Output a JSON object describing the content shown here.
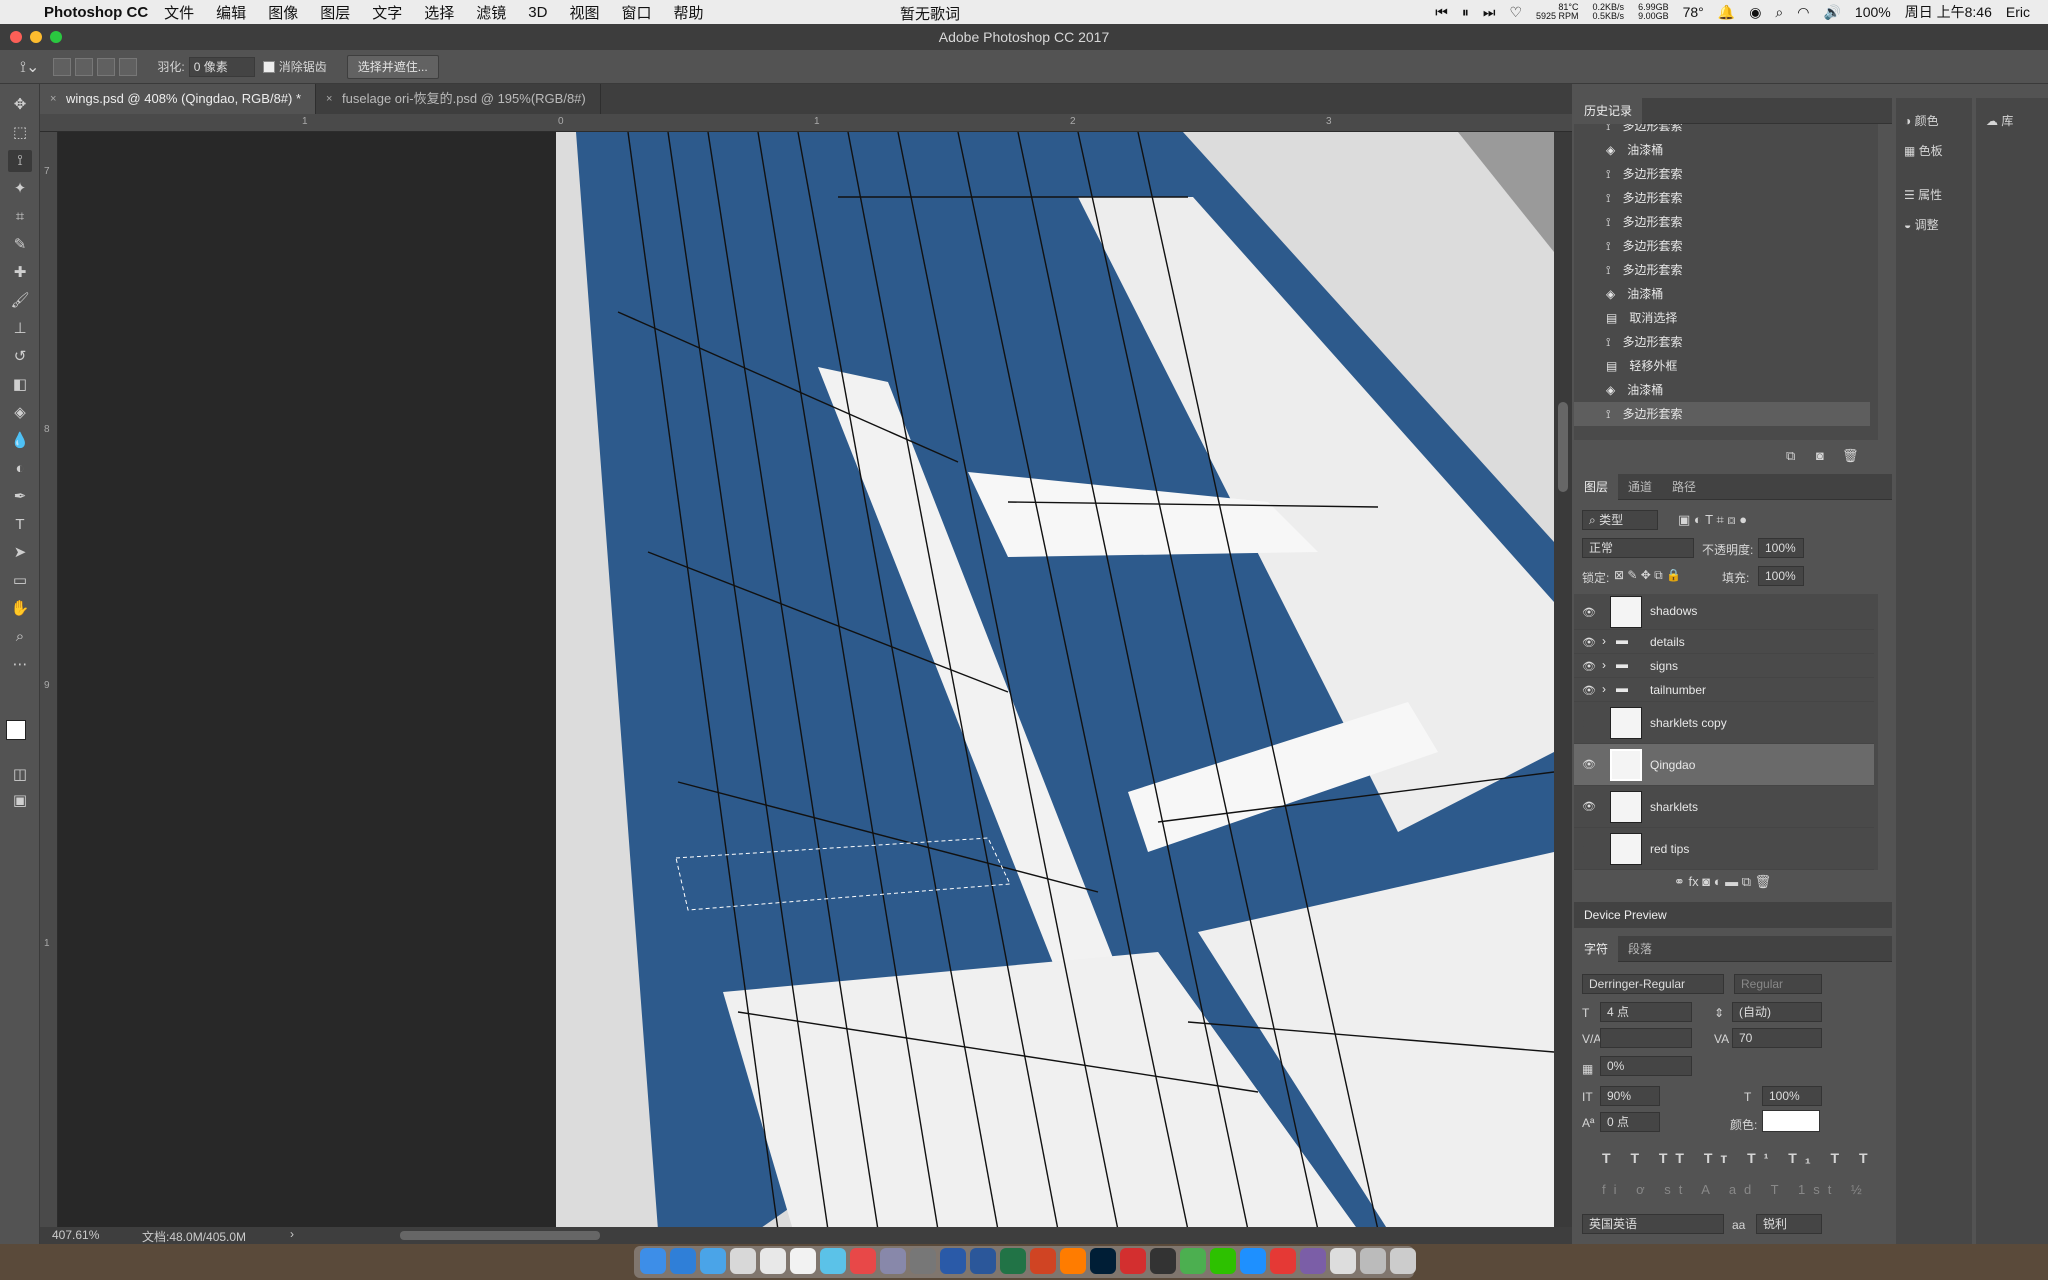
{
  "menubar": {
    "app": "Photoshop CC",
    "items": [
      "文件",
      "编辑",
      "图像",
      "图层",
      "文字",
      "选择",
      "滤镜",
      "3D",
      "视图",
      "窗口",
      "帮助"
    ],
    "center": "暂无歌词",
    "temp": "81°C",
    "rpm": "5925 RPM",
    "net_up": "0.2KB/s",
    "net_down": "0.5KB/s",
    "mem_u": "6.99GB",
    "mem_f": "9.00GB",
    "weather": "78°",
    "battery": "100%",
    "datetime": "周日 上午8:46",
    "user": "Eric"
  },
  "window": {
    "title": "Adobe Photoshop CC 2017"
  },
  "options": {
    "feather_label": "羽化:",
    "feather_value": "0 像素",
    "antialias_label": "消除锯齿",
    "select_mask_button": "选择并遮住..."
  },
  "doc_tabs": [
    {
      "label": "wings.psd @ 408% (Qingdao, RGB/8#) *",
      "active": true
    },
    {
      "label": "fuselage ori-恢复的.psd @ 195%(RGB/8#)",
      "active": false
    }
  ],
  "ruler": {
    "h_labels": [
      "1",
      "0",
      "1",
      "2",
      "3"
    ],
    "v_labels": [
      "7",
      "8",
      "9",
      "1"
    ]
  },
  "status": {
    "zoom": "407.61%",
    "doc": "文档:48.0M/405.0M"
  },
  "history": {
    "title": "历史记录",
    "items": [
      "多边形套索",
      "油漆桶",
      "多边形套索",
      "多边形套索",
      "多边形套索",
      "多边形套索",
      "多边形套索",
      "油漆桶",
      "取消选择",
      "多边形套索",
      "轻移外框",
      "油漆桶",
      "多边形套索"
    ]
  },
  "right_dock": {
    "items": [
      "颜色",
      "色板",
      "属性",
      "调整"
    ],
    "lib": "库"
  },
  "layers": {
    "tabs": [
      "图层",
      "通道",
      "路径"
    ],
    "filter": "类型",
    "blend": "正常",
    "opacity_label": "不透明度:",
    "opacity": "100%",
    "lock_label": "锁定:",
    "fill_label": "填充:",
    "fill": "100%",
    "items": [
      {
        "name": "shadows",
        "visible": true,
        "kind": "layer"
      },
      {
        "name": "details",
        "visible": true,
        "kind": "group"
      },
      {
        "name": "signs",
        "visible": true,
        "kind": "group"
      },
      {
        "name": "tailnumber",
        "visible": true,
        "kind": "group"
      },
      {
        "name": "sharklets copy",
        "visible": false,
        "kind": "layer"
      },
      {
        "name": "Qingdao",
        "visible": true,
        "kind": "layer",
        "selected": true
      },
      {
        "name": "sharklets",
        "visible": true,
        "kind": "layer"
      },
      {
        "name": "red tips",
        "visible": false,
        "kind": "layer"
      }
    ]
  },
  "device_preview": {
    "title": "Device Preview"
  },
  "character": {
    "tabs": [
      "字符",
      "段落"
    ],
    "font": "Derringer-Regular",
    "style": "Regular",
    "size": "4 点",
    "leading": "(自动)",
    "tracking": "70",
    "scale_pct": "0%",
    "vscale": "90%",
    "hscale": "100%",
    "baseline": "0 点",
    "color_label": "颜色:",
    "language": "英国英语",
    "aa": "锐利",
    "aa_label": "aa"
  }
}
